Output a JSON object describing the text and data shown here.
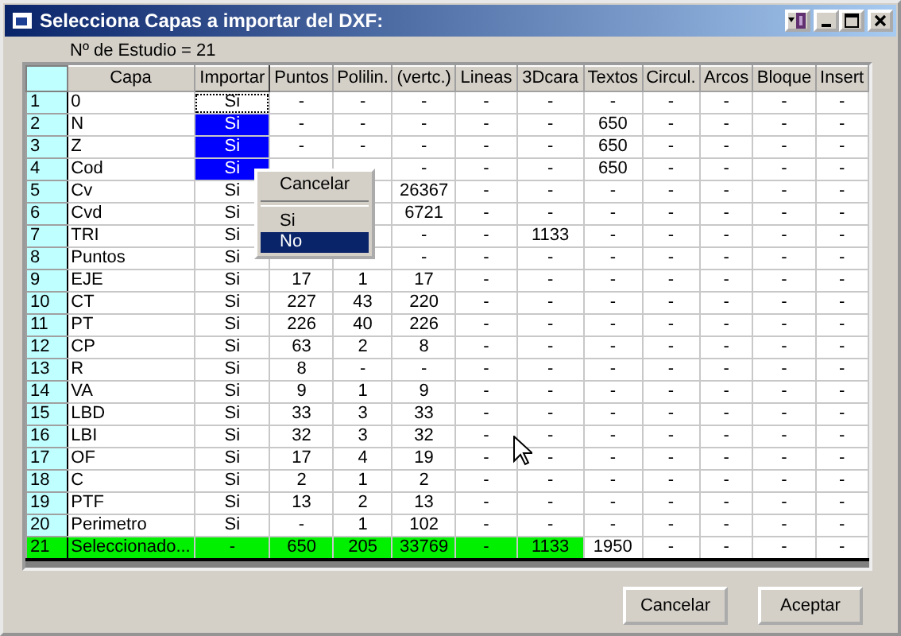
{
  "window": {
    "title": "Selecciona Capas a importar del DXF:"
  },
  "study_label": "Nº de Estudio = 21",
  "table": {
    "columns": [
      "Capa",
      "Importar",
      "Puntos",
      "Polilin.",
      "(vertc.)",
      "Lineas",
      "3Dcara",
      "Textos",
      "Circul.",
      "Arcos",
      "Bloque",
      "Insert"
    ],
    "rows": [
      {
        "number": "1",
        "cells": [
          "0",
          "Si",
          "-",
          "-",
          "-",
          "-",
          "-",
          "-",
          "-",
          "-",
          "-",
          "-"
        ],
        "import_selected": false,
        "import_focused": true
      },
      {
        "number": "2",
        "cells": [
          "N",
          "Si",
          "-",
          "-",
          "-",
          "-",
          "-",
          "650",
          "-",
          "-",
          "-",
          "-"
        ],
        "import_selected": true,
        "import_focused": false
      },
      {
        "number": "3",
        "cells": [
          "Z",
          "Si",
          "-",
          "-",
          "-",
          "-",
          "-",
          "650",
          "-",
          "-",
          "-",
          "-"
        ],
        "import_selected": true,
        "import_focused": false
      },
      {
        "number": "4",
        "cells": [
          "Cod",
          "Si",
          null,
          null,
          "-",
          "-",
          "-",
          "650",
          "-",
          "-",
          "-",
          "-"
        ],
        "import_selected": true,
        "import_focused": false
      },
      {
        "number": "5",
        "cells": [
          "Cv",
          "Si",
          null,
          null,
          "26367",
          "-",
          "-",
          "-",
          "-",
          "-",
          "-",
          "-"
        ],
        "import_selected": false,
        "import_focused": false
      },
      {
        "number": "6",
        "cells": [
          "Cvd",
          "Si",
          null,
          null,
          "6721",
          "-",
          "-",
          "-",
          "-",
          "-",
          "-",
          "-"
        ],
        "import_selected": false,
        "import_focused": false
      },
      {
        "number": "7",
        "cells": [
          "TRI",
          "Si",
          null,
          null,
          "-",
          "-",
          "1133",
          "-",
          "-",
          "-",
          "-",
          "-"
        ],
        "import_selected": false,
        "import_focused": false
      },
      {
        "number": "8",
        "cells": [
          "Puntos",
          "Si",
          null,
          null,
          "-",
          "-",
          "-",
          "-",
          "-",
          "-",
          "-",
          "-"
        ],
        "import_selected": false,
        "import_focused": false
      },
      {
        "number": "9",
        "cells": [
          "EJE",
          "Si",
          "17",
          "1",
          "17",
          "-",
          "-",
          "-",
          "-",
          "-",
          "-",
          "-"
        ],
        "import_selected": false,
        "import_focused": false
      },
      {
        "number": "10",
        "cells": [
          "CT",
          "Si",
          "227",
          "43",
          "220",
          "-",
          "-",
          "-",
          "-",
          "-",
          "-",
          "-"
        ],
        "import_selected": false,
        "import_focused": false
      },
      {
        "number": "11",
        "cells": [
          "PT",
          "Si",
          "226",
          "40",
          "226",
          "-",
          "-",
          "-",
          "-",
          "-",
          "-",
          "-"
        ],
        "import_selected": false,
        "import_focused": false
      },
      {
        "number": "12",
        "cells": [
          "CP",
          "Si",
          "63",
          "2",
          "8",
          "-",
          "-",
          "-",
          "-",
          "-",
          "-",
          "-"
        ],
        "import_selected": false,
        "import_focused": false
      },
      {
        "number": "13",
        "cells": [
          "R",
          "Si",
          "8",
          "-",
          "-",
          "-",
          "-",
          "-",
          "-",
          "-",
          "-",
          "-"
        ],
        "import_selected": false,
        "import_focused": false
      },
      {
        "number": "14",
        "cells": [
          "VA",
          "Si",
          "9",
          "1",
          "9",
          "-",
          "-",
          "-",
          "-",
          "-",
          "-",
          "-"
        ],
        "import_selected": false,
        "import_focused": false
      },
      {
        "number": "15",
        "cells": [
          "LBD",
          "Si",
          "33",
          "3",
          "33",
          "-",
          "-",
          "-",
          "-",
          "-",
          "-",
          "-"
        ],
        "import_selected": false,
        "import_focused": false
      },
      {
        "number": "16",
        "cells": [
          "LBI",
          "Si",
          "32",
          "3",
          "32",
          "-",
          "-",
          "-",
          "-",
          "-",
          "-",
          "-"
        ],
        "import_selected": false,
        "import_focused": false
      },
      {
        "number": "17",
        "cells": [
          "OF",
          "Si",
          "17",
          "4",
          "19",
          "-",
          "-",
          "-",
          "-",
          "-",
          "-",
          "-"
        ],
        "import_selected": false,
        "import_focused": false
      },
      {
        "number": "18",
        "cells": [
          "C",
          "Si",
          "2",
          "1",
          "2",
          "-",
          "-",
          "-",
          "-",
          "-",
          "-",
          "-"
        ],
        "import_selected": false,
        "import_focused": false
      },
      {
        "number": "19",
        "cells": [
          "PTF",
          "Si",
          "13",
          "2",
          "13",
          "-",
          "-",
          "-",
          "-",
          "-",
          "-",
          "-"
        ],
        "import_selected": false,
        "import_focused": false
      },
      {
        "number": "20",
        "cells": [
          "Perimetro",
          "Si",
          "-",
          "1",
          "102",
          "-",
          "-",
          "-",
          "-",
          "-",
          "-",
          "-"
        ],
        "import_selected": false,
        "import_focused": false
      }
    ],
    "summary_row": {
      "number": "21",
      "cells": [
        {
          "text": "Seleccionado...",
          "highlighted": true
        },
        {
          "text": "-",
          "highlighted": true
        },
        {
          "text": "650",
          "highlighted": true
        },
        {
          "text": "205",
          "highlighted": true
        },
        {
          "text": "33769",
          "highlighted": true
        },
        {
          "text": "-",
          "highlighted": true
        },
        {
          "text": "1133",
          "highlighted": true
        },
        {
          "text": "1950",
          "highlighted": false
        },
        {
          "text": "-",
          "highlighted": false
        },
        {
          "text": "-",
          "highlighted": false
        },
        {
          "text": "-",
          "highlighted": false
        },
        {
          "text": "-",
          "highlighted": false
        }
      ]
    }
  },
  "context_menu": {
    "items": [
      {
        "kind": "item",
        "label": "Cancelar",
        "selected": false
      },
      {
        "kind": "separator"
      },
      {
        "kind": "item",
        "label": "Si",
        "selected": false
      },
      {
        "kind": "item",
        "label": "No",
        "selected": true
      }
    ]
  },
  "buttons": [
    "Cancelar",
    "Aceptar"
  ]
}
